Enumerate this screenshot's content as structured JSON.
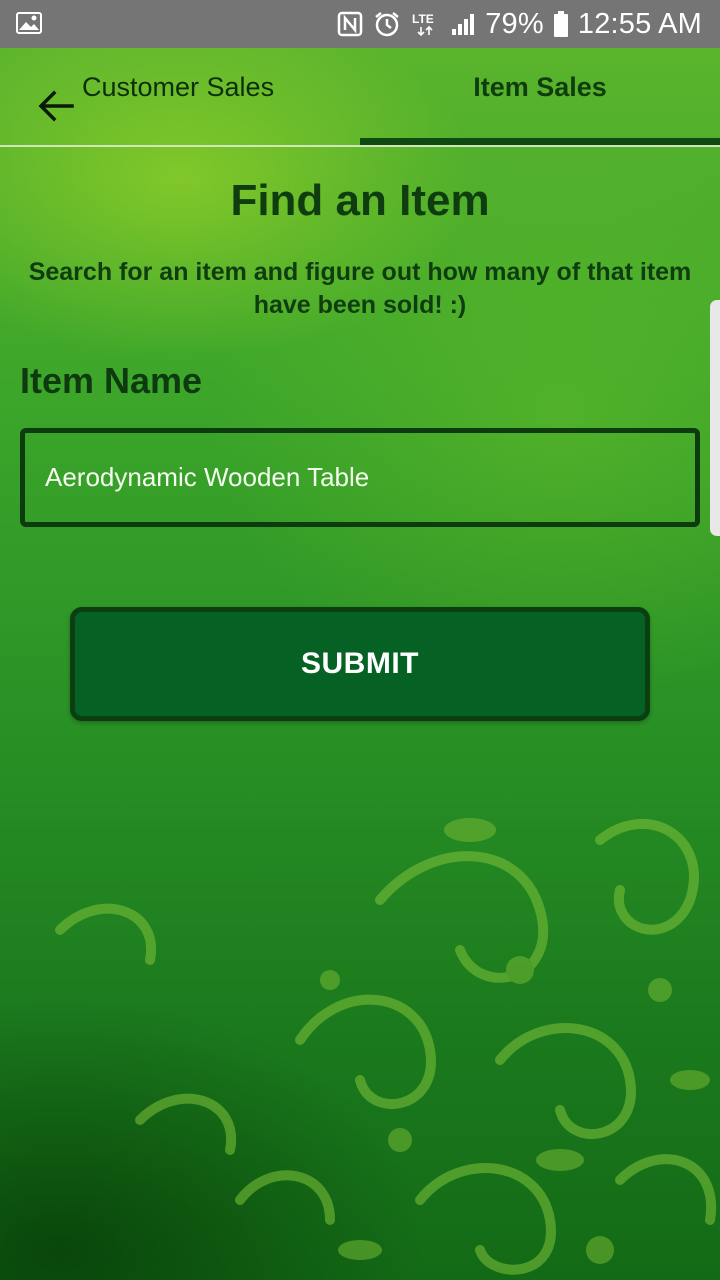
{
  "status_bar": {
    "battery": "79%",
    "time": "12:55 AM",
    "network": "LTE",
    "icons": [
      "gallery-icon",
      "nfc-icon",
      "alarm-icon",
      "lte-icon",
      "signal-icon",
      "battery-icon"
    ]
  },
  "tabs": [
    {
      "label": "Customer Sales",
      "selected": false
    },
    {
      "label": "Item Sales",
      "selected": true
    }
  ],
  "back_icon": "arrow-left-icon",
  "main": {
    "title": "Find an Item",
    "subtitle_line1": "Search for an item and figure out how many of that item",
    "subtitle_line2": "have been sold! :)",
    "field_label": "Item Name",
    "item_value": "Aerodynamic Wooden Table",
    "submit_label": "SUBMIT"
  },
  "colors": {
    "status_bar": "#757575",
    "tab_indicator": "#0f4a12",
    "button_fill": "#066224",
    "text_dark": "#0f3d0f"
  }
}
